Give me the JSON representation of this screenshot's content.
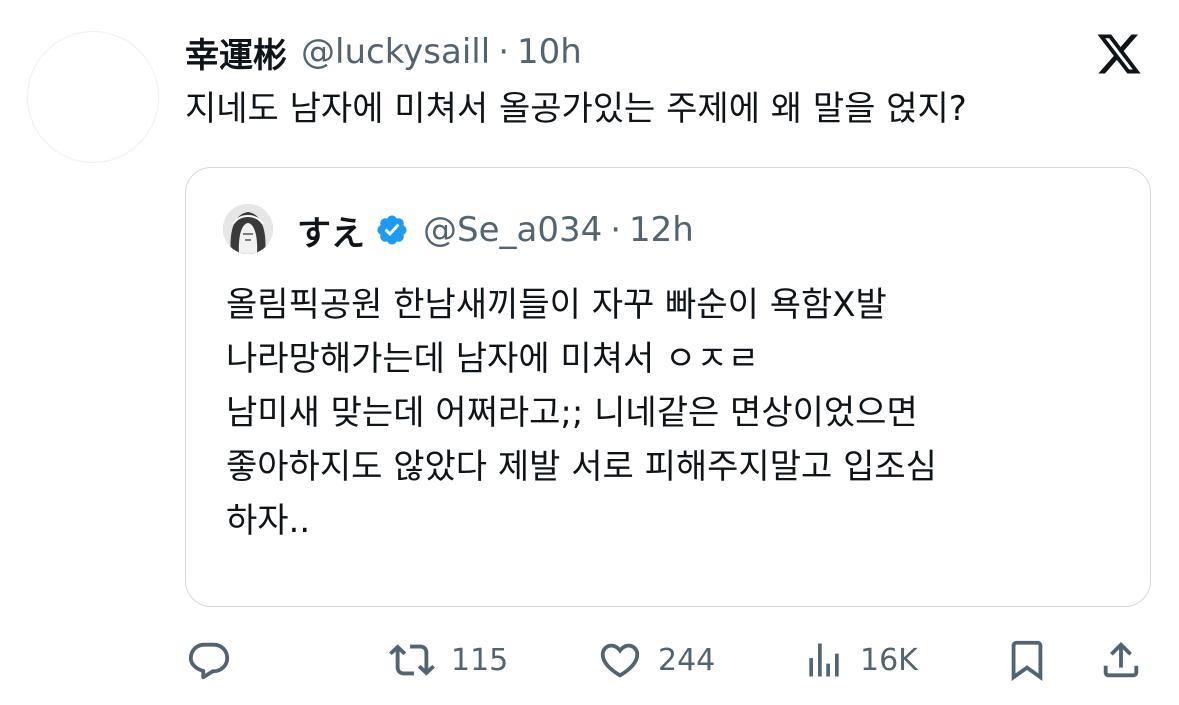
{
  "tweet": {
    "author_name": "幸運彬",
    "author_handle": "@luckysaill",
    "separator": "·",
    "time": "10h",
    "text": "지네도 남자에 미쳐서 올공가있는 주제에 왜 말을 얹지?"
  },
  "quoted": {
    "author_name": "すえ",
    "verified": true,
    "author_handle": "@Se_a034",
    "separator": "·",
    "time": "12h",
    "lines": [
      "올림픽공원 한남새끼들이 자꾸 빠순이 욕함X발",
      "나라망해가는데 남자에 미쳐서 ㅇㅈㄹ",
      "남미새 맞는데 어쩌라고;; 니네같은 면상이었으면",
      "좋아하지도 않았다 제발 서로 피해주지말고 입조심",
      "하자.."
    ]
  },
  "actions": {
    "reply_count": "",
    "retweet_count": "115",
    "like_count": "244",
    "views_count": "16K"
  },
  "icons": {
    "logo": "x-logo-icon",
    "verified": "verified-badge-icon",
    "reply": "reply-icon",
    "retweet": "retweet-icon",
    "like": "heart-icon",
    "views": "views-icon",
    "bookmark": "bookmark-icon",
    "share": "share-icon"
  },
  "colors": {
    "text": "#0f1419",
    "secondary": "#536471",
    "verified": "#1d9bf0",
    "border": "#cfd9de"
  }
}
